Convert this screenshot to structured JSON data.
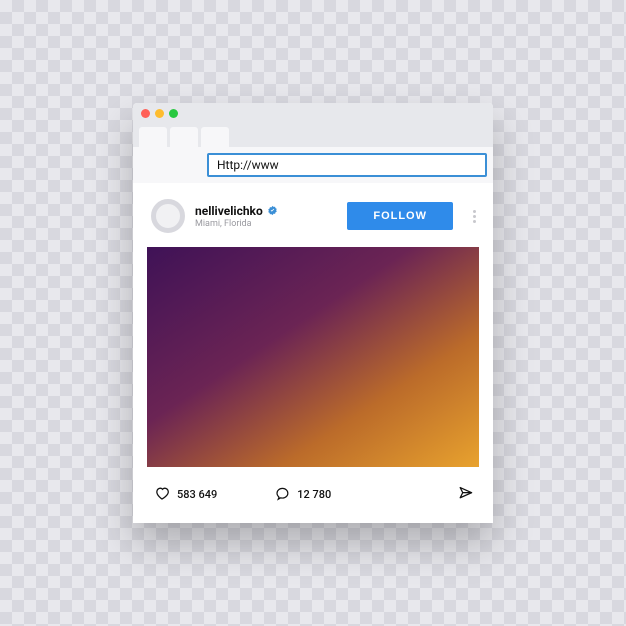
{
  "browser": {
    "address_text": "Http://www"
  },
  "post": {
    "username": "nellivelichko",
    "location": "Miami, Florida",
    "follow_label": "FOLLOW",
    "likes_count": "583 649",
    "comments_count": "12 780"
  }
}
